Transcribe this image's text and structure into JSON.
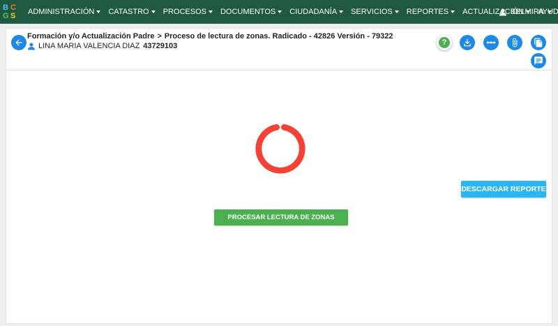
{
  "brand": {
    "letters": [
      "B",
      "C",
      "G",
      "S"
    ]
  },
  "nav": {
    "items": [
      {
        "label": "ADMINISTRACIÓN"
      },
      {
        "label": "CATASTRO"
      },
      {
        "label": "PROCESOS"
      },
      {
        "label": "DOCUMENTOS"
      },
      {
        "label": "CIUDADANÍA"
      },
      {
        "label": "SERVICIOS"
      },
      {
        "label": "REPORTES"
      },
      {
        "label": "ACTUALIZACIÓN"
      },
      {
        "label": "AYUDA"
      }
    ],
    "user": "BELMIRA"
  },
  "header": {
    "parent": "Formación y/o Actualización Padre",
    "process": "Proceso de lectura de zonas. Radicado - 42826 Versión - 79322",
    "person_name": "LINA MARIA VALENCIA DIAZ",
    "person_document": "43729103"
  },
  "actions": {
    "help_glyph": "?",
    "icons": [
      "help-icon",
      "download-icon",
      "flow-icon",
      "attachment-icon",
      "copy-icon",
      "comments-icon"
    ]
  },
  "main": {
    "download_report_label": "DESCARGAR REPORTE",
    "process_zones_label": "PROCESAR LECTURA DE ZONAS"
  },
  "colors": {
    "navbar": "#1f5a40",
    "primary": "#1e88e5",
    "success": "#4caf50",
    "info": "#29b6f6",
    "spinner": "#f44336"
  }
}
